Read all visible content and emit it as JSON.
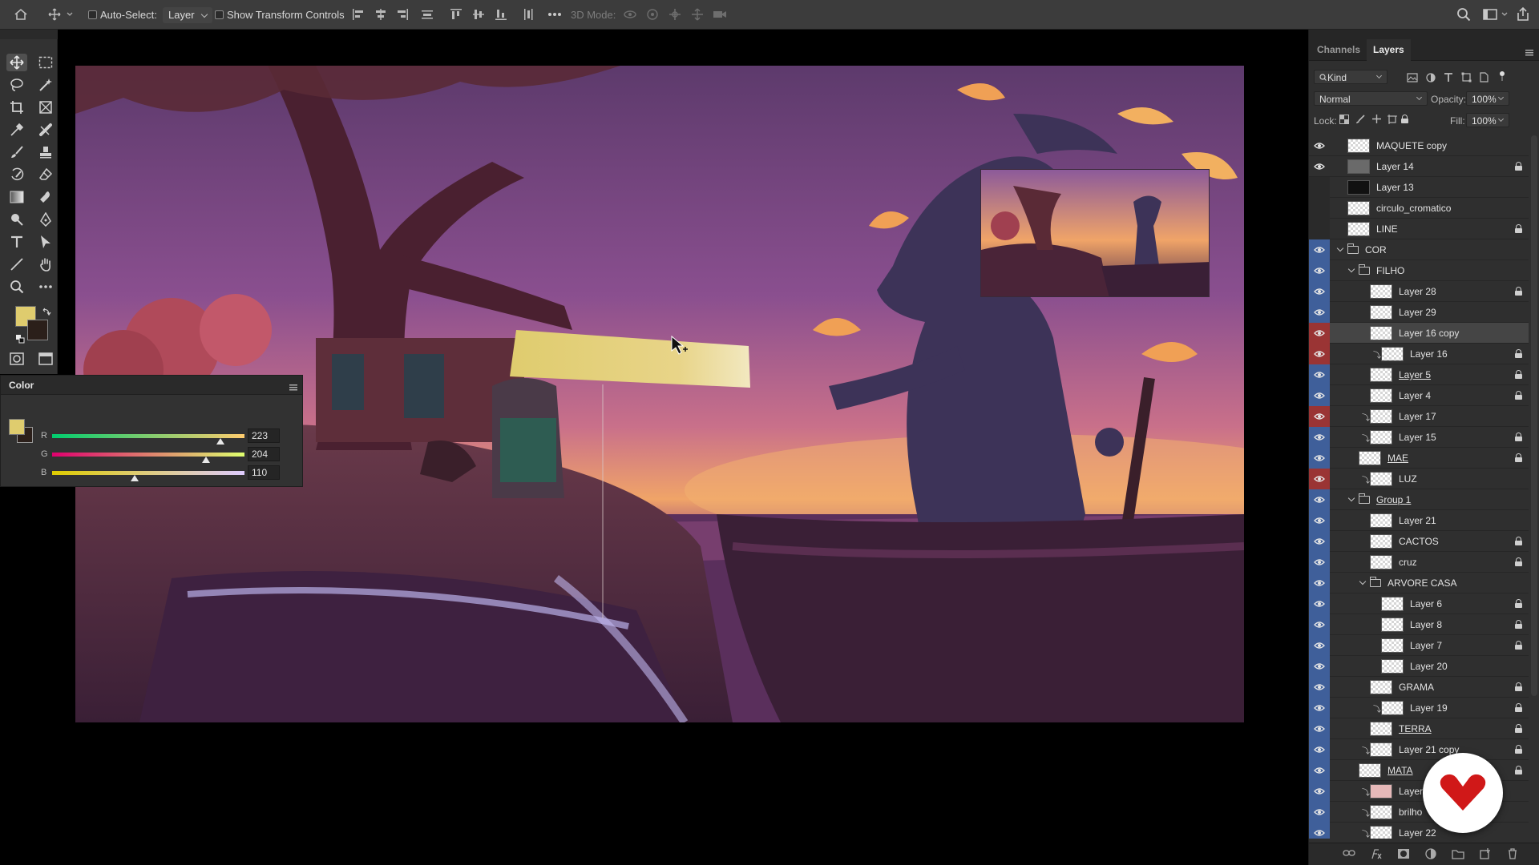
{
  "options_bar": {
    "auto_select_label": "Auto-Select:",
    "auto_select_value": "Layer",
    "show_transform_label": "Show Transform Controls",
    "mode_3d_label": "3D Mode:"
  },
  "color_panel": {
    "title": "Color",
    "foreground_color": "#DFCC6E",
    "background_color": "#2b1f1a",
    "channels": [
      {
        "label": "R",
        "value": "223",
        "fraction": 0.875
      },
      {
        "label": "G",
        "value": "204",
        "fraction": 0.8
      },
      {
        "label": "B",
        "value": "110",
        "fraction": 0.431
      }
    ]
  },
  "layers_panel": {
    "tabs": [
      {
        "label": "Channels",
        "active": false
      },
      {
        "label": "Layers",
        "active": true
      }
    ],
    "filter_kind": "Kind",
    "blend_mode": "Normal",
    "opacity_label": "Opacity:",
    "opacity_value": "100%",
    "lock_label": "Lock:",
    "fill_label": "Fill:",
    "fill_value": "100%",
    "layers": [
      {
        "name": "MAQUETE copy",
        "indent": 0,
        "eye": "plain",
        "thumb": "checker",
        "locked": false
      },
      {
        "name": "Layer 14",
        "indent": 0,
        "eye": "plain",
        "thumb": "gray",
        "locked": true
      },
      {
        "name": "Layer 13",
        "indent": 0,
        "eye": "none",
        "thumb": "dark",
        "locked": false
      },
      {
        "name": "circulo_cromatico",
        "indent": 0,
        "eye": "none",
        "thumb": "checker",
        "locked": false
      },
      {
        "name": "LINE",
        "indent": 0,
        "eye": "none",
        "thumb": "checker",
        "locked": true
      },
      {
        "name": "COR",
        "indent": 0,
        "eye": "blue",
        "group": true
      },
      {
        "name": "FILHO",
        "indent": 1,
        "eye": "blue",
        "group": true
      },
      {
        "name": "Layer 28",
        "indent": 2,
        "eye": "blue",
        "thumb": "checker",
        "locked": true
      },
      {
        "name": "Layer 29",
        "indent": 2,
        "eye": "blue",
        "thumb": "checker",
        "locked": false
      },
      {
        "name": "Layer 16 copy",
        "indent": 2,
        "eye": "red",
        "thumb": "checker",
        "locked": false,
        "selected": true
      },
      {
        "name": "Layer 16",
        "indent": 3,
        "eye": "red",
        "thumb": "checker",
        "locked": true,
        "clipped": true
      },
      {
        "name": "Layer 5",
        "indent": 2,
        "eye": "blue",
        "thumb": "checker",
        "locked": true,
        "underline": true
      },
      {
        "name": "Layer 4",
        "indent": 2,
        "eye": "blue",
        "thumb": "checker",
        "locked": true
      },
      {
        "name": "Layer 17",
        "indent": 2,
        "eye": "red",
        "thumb": "checker",
        "locked": false,
        "clipped": true
      },
      {
        "name": "Layer 15",
        "indent": 2,
        "eye": "blue",
        "thumb": "checker",
        "locked": true,
        "clipped": true
      },
      {
        "name": "MAE",
        "indent": 1,
        "eye": "blue",
        "thumb": "checker",
        "locked": true,
        "underline": true
      },
      {
        "name": "LUZ",
        "indent": 2,
        "eye": "red",
        "thumb": "checker",
        "locked": false,
        "clipped": true
      },
      {
        "name": "Group 1",
        "indent": 1,
        "eye": "blue",
        "group": true,
        "underline": true
      },
      {
        "name": "Layer 21",
        "indent": 2,
        "eye": "blue",
        "thumb": "checker",
        "locked": false
      },
      {
        "name": "CACTOS",
        "indent": 2,
        "eye": "blue",
        "thumb": "checker",
        "locked": true
      },
      {
        "name": "cruz",
        "indent": 2,
        "eye": "blue",
        "thumb": "checker",
        "locked": true
      },
      {
        "name": "ARVORE CASA",
        "indent": 2,
        "eye": "blue",
        "group": true
      },
      {
        "name": "Layer 6",
        "indent": 3,
        "eye": "blue",
        "thumb": "checker",
        "locked": true
      },
      {
        "name": "Layer 8",
        "indent": 3,
        "eye": "blue",
        "thumb": "checker",
        "locked": true
      },
      {
        "name": "Layer 7",
        "indent": 3,
        "eye": "blue",
        "thumb": "checker",
        "locked": true
      },
      {
        "name": "Layer 20",
        "indent": 3,
        "eye": "blue",
        "thumb": "checker",
        "locked": false
      },
      {
        "name": "GRAMA",
        "indent": 2,
        "eye": "blue",
        "thumb": "checker",
        "locked": true
      },
      {
        "name": "Layer 19",
        "indent": 3,
        "eye": "blue",
        "thumb": "checker",
        "locked": true,
        "clipped": true
      },
      {
        "name": "TERRA",
        "indent": 2,
        "eye": "blue",
        "thumb": "checker",
        "locked": true,
        "underline": true
      },
      {
        "name": "Layer 21 copy",
        "indent": 2,
        "eye": "blue",
        "thumb": "checker",
        "locked": true,
        "clipped": true
      },
      {
        "name": "MATA",
        "indent": 1,
        "eye": "blue",
        "thumb": "checker",
        "locked": true,
        "underline": true
      },
      {
        "name": "Layer",
        "indent": 2,
        "eye": "blue",
        "thumb": "pink",
        "locked": false,
        "clipped": true
      },
      {
        "name": "brilho",
        "indent": 2,
        "eye": "blue",
        "thumb": "checker",
        "locked": false,
        "clipped": true
      },
      {
        "name": "Layer 22",
        "indent": 2,
        "eye": "blue",
        "thumb": "checker",
        "locked": false,
        "clipped": true
      }
    ]
  },
  "canvas": {
    "swatch_color": "#DFCC6E",
    "sky_top": "#6a3a6e",
    "horizon_color": "#f0a468"
  },
  "brand": {
    "logo_color": "#d01818"
  }
}
